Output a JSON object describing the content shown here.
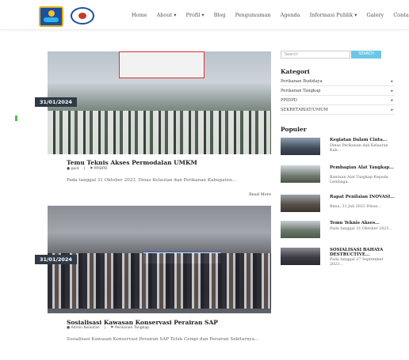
{
  "header": {
    "nav": [
      "Home",
      "About ▾",
      "Profil ▾",
      "Blog",
      "Pengumuman",
      "Agenda",
      "Informasi Publik ▾",
      "Galery",
      "Contact"
    ]
  },
  "posts": [
    {
      "date": "31/01/2024",
      "title": "Temu Teknis Akses Permodalan UMKM",
      "author": "ppid",
      "category": "PPIDPD",
      "excerpt": "Pada tanggal 31 Oktober 2023, Dinas Kelautan dan Perikanan Kabupaten..."
    },
    {
      "date": "31/01/2024",
      "title": "Sosialisasi Kawasan Konservasi Perairan SAP",
      "author": "Admin Kelautan",
      "category": "Perikanan Tangkap",
      "excerpt": "Sosialisasi Kawasan Konservasi Perairan SAP Teluk Cempi dan Perairan Sekitarnya..."
    }
  ],
  "read_more": "Read More",
  "sidebar": {
    "search_placeholder": "Search",
    "search_button": "SEARCH",
    "categories_heading": "Kategori",
    "categories": [
      "Perikanan Budidaya",
      "Perikanan Tangkap",
      "PPIDPD",
      "SEKRETARIAT/UMUM"
    ],
    "popular_heading": "Populer",
    "popular": [
      {
        "title": "Kegiatan Dalam Cinta...",
        "text": "Dinas Perikanan dan Kelautan Kab..."
      },
      {
        "title": "Pembagian Alat Tangkap...",
        "text": "Bantuan Alat Tangkap Kepada Lembaga..."
      },
      {
        "title": "Rapat Penilaian INOVASI...",
        "text": "Bima, 31 Juli 2023 Dinas..."
      },
      {
        "title": "Temu Teknis Akses...",
        "text": "Pada tanggal 31 Oktober 2023..."
      },
      {
        "title": "SOSIALISASI BAHAYA DESTRUCTIVE...",
        "text": "Pada tanggal 27 September 2023..."
      }
    ]
  },
  "colors": {
    "accent": "#6cc7e6",
    "badge": "#2f3a46",
    "green_tab": "#4cc04a"
  }
}
